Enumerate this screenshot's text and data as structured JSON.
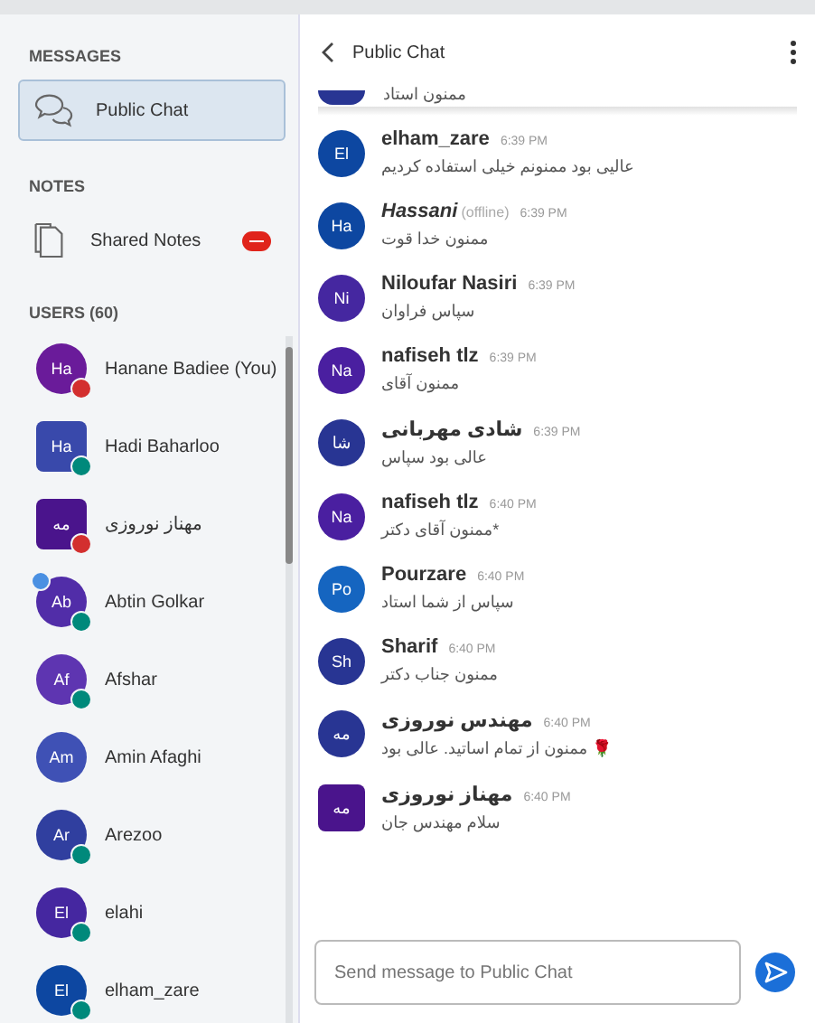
{
  "sidebar": {
    "messages_heading": "MESSAGES",
    "public_chat": {
      "label": "Public Chat",
      "selected": true
    },
    "notes_heading": "NOTES",
    "shared_notes": {
      "label": "Shared Notes",
      "unread": true
    },
    "users_heading": "USERS (60)",
    "users": [
      {
        "initials": "Ha",
        "name": "Hanane Badiee (You)",
        "moderator": false,
        "color": "#6a1b9a",
        "muted": true,
        "listening": false,
        "presenter": false
      },
      {
        "initials": "Ha",
        "name": "Hadi Baharloo",
        "moderator": true,
        "color": "#3949ab",
        "muted": false,
        "listening": true,
        "presenter": false
      },
      {
        "initials": "مه",
        "name": "مهناز نوروزی",
        "moderator": true,
        "color": "#4a148c",
        "muted": true,
        "listening": false,
        "presenter": false
      },
      {
        "initials": "Ab",
        "name": "Abtin Golkar",
        "moderator": false,
        "color": "#512da8",
        "muted": false,
        "listening": true,
        "presenter": true
      },
      {
        "initials": "Af",
        "name": "Afshar",
        "moderator": false,
        "color": "#5e35b1",
        "muted": false,
        "listening": true,
        "presenter": false
      },
      {
        "initials": "Am",
        "name": "Amin Afaghi",
        "moderator": false,
        "color": "#3f51b5",
        "muted": false,
        "listening": false,
        "presenter": false
      },
      {
        "initials": "Ar",
        "name": "Arezoo",
        "moderator": false,
        "color": "#303f9f",
        "muted": false,
        "listening": true,
        "presenter": false
      },
      {
        "initials": "El",
        "name": "elahi",
        "moderator": false,
        "color": "#4527a0",
        "muted": false,
        "listening": true,
        "presenter": false
      },
      {
        "initials": "El",
        "name": "elham_zare",
        "moderator": false,
        "color": "#0d47a1",
        "muted": false,
        "listening": true,
        "presenter": false
      }
    ]
  },
  "chat": {
    "title": "Public Chat",
    "first_message_text": "ممنون استاد",
    "messages": [
      {
        "initials": "El",
        "name": "elham_zare",
        "offline": false,
        "time": "6:39 PM",
        "text": "عالیی بود ممنونم خیلی استفاده کردیم",
        "moderator": false,
        "color": "#0d47a1"
      },
      {
        "initials": "Ha",
        "name": "Hassani",
        "offline": true,
        "offline_label": "(offline)",
        "time": "6:39 PM",
        "text": "ممنون خدا قوت",
        "moderator": false,
        "color": "#0d47a1"
      },
      {
        "initials": "Ni",
        "name": "Niloufar Nasiri",
        "offline": false,
        "time": "6:39 PM",
        "text": "سپاس فراوان",
        "moderator": false,
        "color": "#4527a0"
      },
      {
        "initials": "Na",
        "name": "nafiseh tlz",
        "offline": false,
        "time": "6:39 PM",
        "text": "ممنون آقای",
        "moderator": false,
        "color": "#4a1fa0"
      },
      {
        "initials": "شا",
        "name": "شادی مهربانی",
        "offline": false,
        "time": "6:39 PM",
        "text": "عالی بود سپاس",
        "moderator": false,
        "color": "#283593"
      },
      {
        "initials": "Na",
        "name": "nafiseh tlz",
        "offline": false,
        "time": "6:40 PM",
        "text": "*ممنون آقای دکتر",
        "moderator": false,
        "color": "#4a1fa0"
      },
      {
        "initials": "Po",
        "name": "Pourzare",
        "offline": false,
        "time": "6:40 PM",
        "text": "سپاس از شما استاد",
        "moderator": false,
        "color": "#1565c0"
      },
      {
        "initials": "Sh",
        "name": "Sharif",
        "offline": false,
        "time": "6:40 PM",
        "text": "ممنون جناب دکتر",
        "moderator": false,
        "color": "#283593"
      },
      {
        "initials": "مه",
        "name": "مهندس نوروزی",
        "offline": false,
        "time": "6:40 PM",
        "text": "🌹 ممنون از تمام اساتید. عالی بود",
        "moderator": false,
        "color": "#283593"
      },
      {
        "initials": "مه",
        "name": "مهناز نوروزی",
        "offline": false,
        "time": "6:40 PM",
        "text": "سلام مهندس جان",
        "moderator": true,
        "color": "#4a148c"
      }
    ],
    "input": {
      "placeholder": "Send message to Public Chat"
    }
  }
}
